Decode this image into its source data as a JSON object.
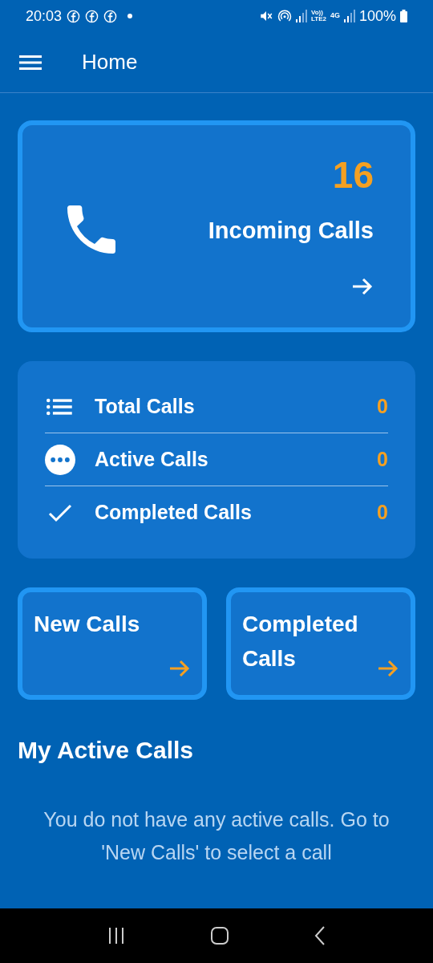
{
  "status_bar": {
    "time": "20:03",
    "volte": "Vo))",
    "lte": "LTE2",
    "network": "4G",
    "battery": "100%"
  },
  "app_bar": {
    "title": "Home"
  },
  "incoming_card": {
    "count": "16",
    "label": "Incoming Calls"
  },
  "stats": [
    {
      "kind": "list",
      "label": "Total Calls",
      "value": "0"
    },
    {
      "kind": "more",
      "label": "Active Calls",
      "value": "0"
    },
    {
      "kind": "check",
      "label": "Completed Calls",
      "value": "0"
    }
  ],
  "shortcut_cards": [
    {
      "label": "New Calls"
    },
    {
      "label": "Completed Calls"
    }
  ],
  "active_calls": {
    "heading": "My Active Calls",
    "empty_message": "You do not have any active calls. Go to 'New Calls' to select a call"
  }
}
